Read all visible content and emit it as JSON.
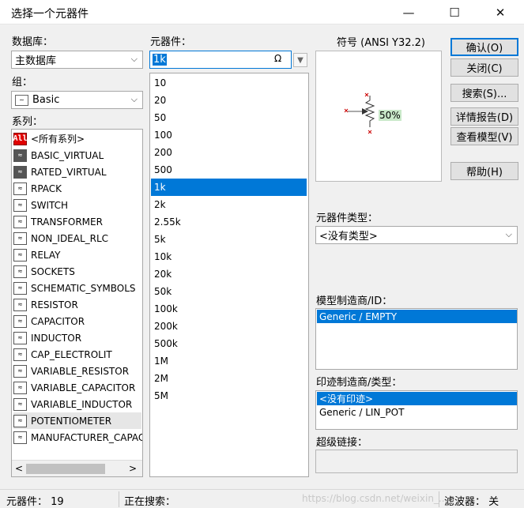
{
  "window": {
    "title": "选择一个元器件",
    "minimize": "—",
    "maximize": "☐",
    "close": "✕"
  },
  "database": {
    "label": "数据库：",
    "value": "主数据库"
  },
  "group": {
    "label": "组：",
    "value": "Basic"
  },
  "family": {
    "label": "系列：",
    "items": [
      {
        "name": "<所有系列>",
        "icon": "All"
      },
      {
        "name": "BASIC_VIRTUAL",
        "icon": "basic-virtual-icon"
      },
      {
        "name": "RATED_VIRTUAL",
        "icon": "rated-virtual-icon"
      },
      {
        "name": "RPACK",
        "icon": "rpack-icon"
      },
      {
        "name": "SWITCH",
        "icon": "switch-icon"
      },
      {
        "name": "TRANSFORMER",
        "icon": "transformer-icon"
      },
      {
        "name": "NON_IDEAL_RLC",
        "icon": "non-ideal-rlc-icon"
      },
      {
        "name": "RELAY",
        "icon": "relay-icon"
      },
      {
        "name": "SOCKETS",
        "icon": "sockets-icon"
      },
      {
        "name": "SCHEMATIC_SYMBOLS",
        "icon": "schematic-symbols-icon"
      },
      {
        "name": "RESISTOR",
        "icon": "resistor-icon"
      },
      {
        "name": "CAPACITOR",
        "icon": "capacitor-icon"
      },
      {
        "name": "INDUCTOR",
        "icon": "inductor-icon"
      },
      {
        "name": "CAP_ELECTROLIT",
        "icon": "cap-electrolit-icon"
      },
      {
        "name": "VARIABLE_RESISTOR",
        "icon": "variable-resistor-icon"
      },
      {
        "name": "VARIABLE_CAPACITOR",
        "icon": "variable-capacitor-icon"
      },
      {
        "name": "VARIABLE_INDUCTOR",
        "icon": "variable-inductor-icon"
      },
      {
        "name": "POTENTIOMETER",
        "icon": "potentiometer-icon"
      },
      {
        "name": "MANUFACTURER_CAPAC",
        "icon": "manufacturer-capacitor-icon"
      }
    ],
    "selected": "POTENTIOMETER"
  },
  "component": {
    "label": "元器件：",
    "search_value": "1k",
    "items": [
      "10",
      "20",
      "50",
      "100",
      "200",
      "500",
      "1k",
      "2k",
      "2.55k",
      "5k",
      "10k",
      "20k",
      "50k",
      "100k",
      "200k",
      "500k",
      "1M",
      "2M",
      "5M"
    ],
    "selected": "1k"
  },
  "symbol": {
    "label": "符号 (ANSI Y32.2)",
    "percent": "50%"
  },
  "buttons": {
    "ok": "确认(O)",
    "close": "关闭(C)",
    "search": "搜索(S)...",
    "detail": "详情报告(D)",
    "model": "查看模型(V)",
    "help": "帮助(H)"
  },
  "component_type": {
    "label": "元器件类型：",
    "value": "<没有类型>"
  },
  "model_manufacturer": {
    "label": "模型制造商/ID：",
    "items": [
      "Generic / EMPTY"
    ]
  },
  "footprint": {
    "label": "印迹制造商/类型：",
    "items": [
      "<没有印迹>",
      "Generic / LIN_POT"
    ]
  },
  "hyperlink": {
    "label": "超级链接："
  },
  "status": {
    "count": "元器件：  19",
    "searching": "正在搜索：",
    "watermark": "https://blog.csdn.net/weixin_...",
    "filter": "滤波器：  关"
  }
}
